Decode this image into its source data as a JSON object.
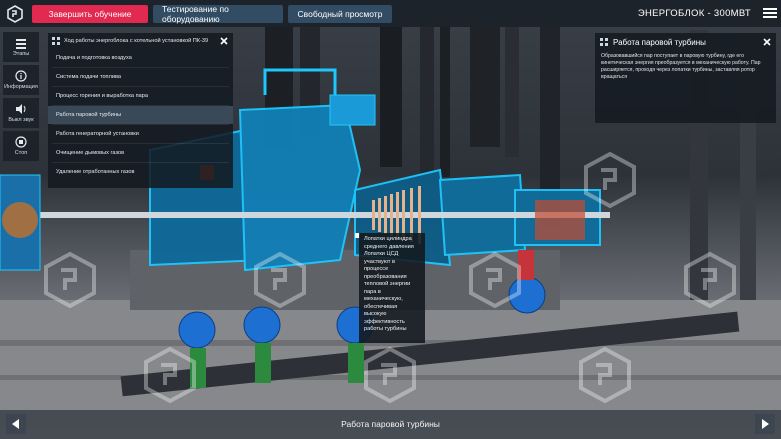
{
  "topbar": {
    "finish_label": "Завершить обучение",
    "testing_label": "Тестирование по оборудованию",
    "free_view_label": "Свободный просмотр",
    "unit_title": "ЭНЕРГОБЛОК - 300МВТ"
  },
  "rail": {
    "stages_label": "Этапы",
    "info_label": "Информация",
    "sound_label": "Выкл звук",
    "stop_label": "Стоп"
  },
  "stage_panel": {
    "title": "Ход работы энергоблока с котельной установкой ПК-39",
    "items": [
      {
        "label": "Подача и подготовка воздуха"
      },
      {
        "label": "Система подачи топлива"
      },
      {
        "label": "Процесс горения и выработка пара"
      },
      {
        "label": "Работа паровой турбины"
      },
      {
        "label": "Работа генераторной установки"
      },
      {
        "label": "Очищение дымовых газов"
      },
      {
        "label": "Удаление отработанных газов"
      }
    ],
    "active_index": 3
  },
  "info_panel": {
    "title": "Работа паровой турбины",
    "text": "Образовавшийся пар поступает в паровую турбину, где его кинетическая энергия преобразуется в механическую работу. Пар расширяется, проходя через лопатки турбины, заставляя ротор вращаться"
  },
  "callout": {
    "text": "Лопатки цилиндра среднего давления\nЛопатки ЦСД участвуют в процессе преобразования тепловой энергии пара в механическую, обеспечивая высокую эффективность работы турбины"
  },
  "bottombar": {
    "title": "Работа паровой турбины"
  },
  "colors": {
    "accent_red": "#e2294f",
    "button_blue": "#324c64",
    "turbine_cyan": "#1ec8ff"
  }
}
